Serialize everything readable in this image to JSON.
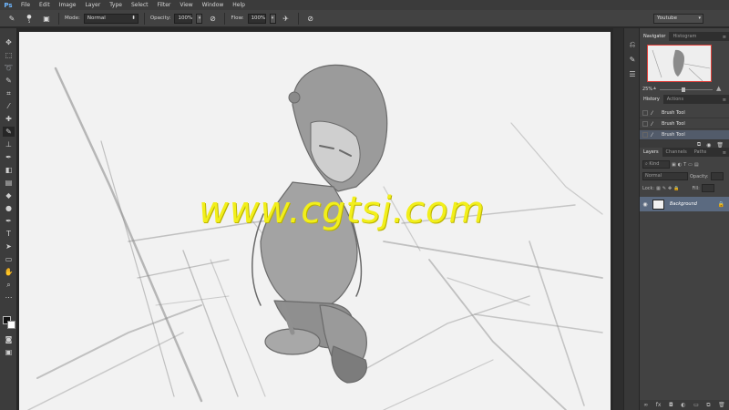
{
  "app": {
    "logo": "Ps"
  },
  "menu": [
    "File",
    "Edit",
    "Image",
    "Layer",
    "Type",
    "Select",
    "Filter",
    "View",
    "Window",
    "Help"
  ],
  "options": {
    "brush_size": "5",
    "mode_label": "Mode:",
    "mode_value": "Normal",
    "opacity_label": "Opacity:",
    "opacity_value": "100%",
    "flow_label": "Flow:",
    "flow_value": "100%",
    "workspace": "Youtube"
  },
  "canvas": {
    "watermark": "www.cgtsj.com",
    "bg_color": "#f2f2f2",
    "sketch_color": "#8a8a8a"
  },
  "navigator": {
    "tabs": [
      "Navigator",
      "Histogram"
    ],
    "zoom": "25%",
    "view_box_color": "#e0403a"
  },
  "history": {
    "tabs": [
      "History",
      "Actions"
    ],
    "items": [
      "Brush Tool",
      "Brush Tool",
      "Brush Tool"
    ]
  },
  "layers": {
    "tabs": [
      "Layers",
      "Channels",
      "Paths"
    ],
    "kind": "Kind",
    "blend": "Normal",
    "opacity_label": "Opacity:",
    "lock_label": "Lock:",
    "fill_label": "Fill:",
    "items": [
      {
        "name": "Background",
        "visible": true,
        "locked": true
      }
    ],
    "selected_color": "#5b6a80"
  },
  "colors": {
    "foreground": "#111111",
    "background": "#ffffff"
  }
}
